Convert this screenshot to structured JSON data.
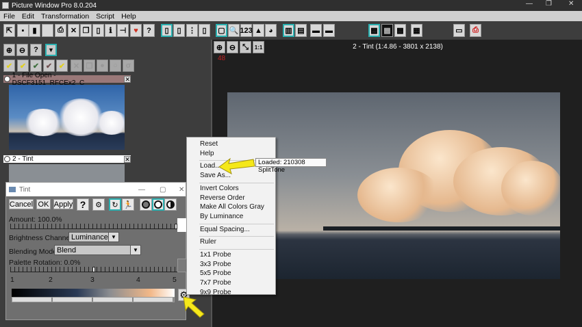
{
  "window": {
    "title": "Picture Window Pro 8.0.204",
    "min": "—",
    "max": "❐",
    "close": "✕"
  },
  "menu": [
    "File",
    "Edit",
    "Transformation",
    "Script",
    "Help"
  ],
  "toolbar": [
    {
      "name": "open-icon",
      "glyph": "⇱"
    },
    {
      "name": "save-icon",
      "glyph": "▪"
    },
    {
      "name": "sd-card-icon",
      "glyph": "▮"
    },
    {
      "name": "new-icon",
      "glyph": ""
    },
    {
      "name": "print-icon",
      "glyph": "⎙"
    },
    {
      "name": "close-icon",
      "glyph": "✕"
    },
    {
      "name": "copy-icon",
      "glyph": "❐"
    },
    {
      "name": "paste-icon",
      "glyph": "▯"
    },
    {
      "name": "info-icon",
      "glyph": "ℹ"
    },
    {
      "name": "tree-icon",
      "glyph": "⊣"
    },
    {
      "name": "favorite-heart-icon",
      "glyph": "♥"
    },
    {
      "name": "help-icon",
      "glyph": "?"
    },
    {
      "name": "layout-1-icon",
      "glyph": "▯"
    },
    {
      "name": "layout-2-icon",
      "glyph": "▯"
    },
    {
      "name": "layout-3-icon",
      "glyph": "⋮"
    },
    {
      "name": "layout-4-icon",
      "glyph": "▯"
    },
    {
      "name": "mouse-icon",
      "glyph": "▢"
    },
    {
      "name": "magnifier-icon",
      "glyph": "🔍"
    },
    {
      "name": "numeric-readout-icon",
      "glyph": "123"
    },
    {
      "name": "histogram-icon",
      "glyph": "▲"
    },
    {
      "name": "palette-icon",
      "glyph": "◕"
    },
    {
      "name": "split-vertical-icon",
      "glyph": "▥"
    },
    {
      "name": "split-horizontal-icon",
      "glyph": "▤"
    },
    {
      "name": "gradient-red-icon",
      "glyph": "▬"
    },
    {
      "name": "gradient-cyan-icon",
      "glyph": "▬"
    },
    {
      "name": "checker-gray-icon",
      "glyph": "▩"
    },
    {
      "name": "checker-black-icon",
      "glyph": "▩"
    },
    {
      "name": "checker-white-icon",
      "glyph": "▩"
    },
    {
      "name": "grid-icon",
      "glyph": "▦"
    },
    {
      "name": "monitor-icon",
      "glyph": "▭"
    },
    {
      "name": "printer-red-icon",
      "glyph": "⎙"
    }
  ],
  "panel": {
    "tools": [
      {
        "name": "zoom-in-icon",
        "glyph": "⊕"
      },
      {
        "name": "zoom-out-icon",
        "glyph": "⊖"
      },
      {
        "name": "help-icon",
        "glyph": "?"
      },
      {
        "name": "dropdown-icon",
        "glyph": "▼"
      }
    ],
    "checks": [
      {
        "name": "check-yellow-icon",
        "glyph": "✔"
      },
      {
        "name": "check-multi-yellow-icon",
        "glyph": "✔"
      },
      {
        "name": "check-green-icon",
        "glyph": "✔"
      },
      {
        "name": "check-dark-icon",
        "glyph": "✔"
      },
      {
        "name": "check-double-icon",
        "glyph": "✔"
      },
      {
        "name": "delete-icon",
        "glyph": "✕"
      },
      {
        "name": "copy-icon",
        "glyph": "❐"
      },
      {
        "name": "circle-icon",
        "glyph": "●"
      },
      {
        "name": "circle-outline-icon",
        "glyph": "○"
      },
      {
        "name": "script-icon",
        "glyph": "σ"
      }
    ],
    "thumbs": [
      {
        "label": "1 - File Open - DSCF3151_RFCEx2_C",
        "close": "✕"
      },
      {
        "label": "2 - Tint",
        "close": "✕"
      }
    ]
  },
  "view": {
    "title": "2 - Tint (1:4.86 - 3801 x 2138)",
    "readout": "48",
    "zoom_buttons": [
      {
        "name": "zoom-in-icon",
        "glyph": "⊕"
      },
      {
        "name": "zoom-out-icon",
        "glyph": "⊖"
      },
      {
        "name": "fit-icon",
        "glyph": "⤡"
      },
      {
        "name": "actual-size-icon",
        "glyph": "1:1"
      }
    ]
  },
  "dialog": {
    "title": "Tint",
    "min": "—",
    "max": "▢",
    "close": "✕",
    "cancel": "Cancel",
    "ok": "OK",
    "apply": "Apply",
    "help": "?",
    "settings": "⚙",
    "refresh": "↻",
    "run": "🏃",
    "amount": "Amount: 100.0%",
    "amount_value": 1.0,
    "brightness_label": "Brightness Channel:",
    "brightness_value": "Luminance",
    "blend_label": "Blending Mode:",
    "blend_value": "Blend",
    "rotation_label": "Palette Rotation: 0.0%",
    "rotation_value": 0.5,
    "stops": [
      "1",
      "2",
      "3",
      "4",
      "5"
    ],
    "gear": "⚙"
  },
  "context_menu": {
    "items": [
      [
        "Reset",
        "Help"
      ],
      [
        "Load...",
        "Save As..."
      ],
      [
        "Invert Colors",
        "Reverse Order",
        "Make All Colors Gray",
        "By Luminance"
      ],
      [
        "Equal Spacing..."
      ],
      [
        "Ruler"
      ],
      [
        "1x1 Probe",
        "3x3 Probe",
        "5x5 Probe",
        "7x7 Probe",
        "9x9 Probe"
      ]
    ]
  },
  "tooltip": "Loaded: 210308 SplitTone",
  "colors": {
    "accent": "#2ab0b0",
    "arrow": "#f5e81a",
    "readout": "#c02020"
  }
}
